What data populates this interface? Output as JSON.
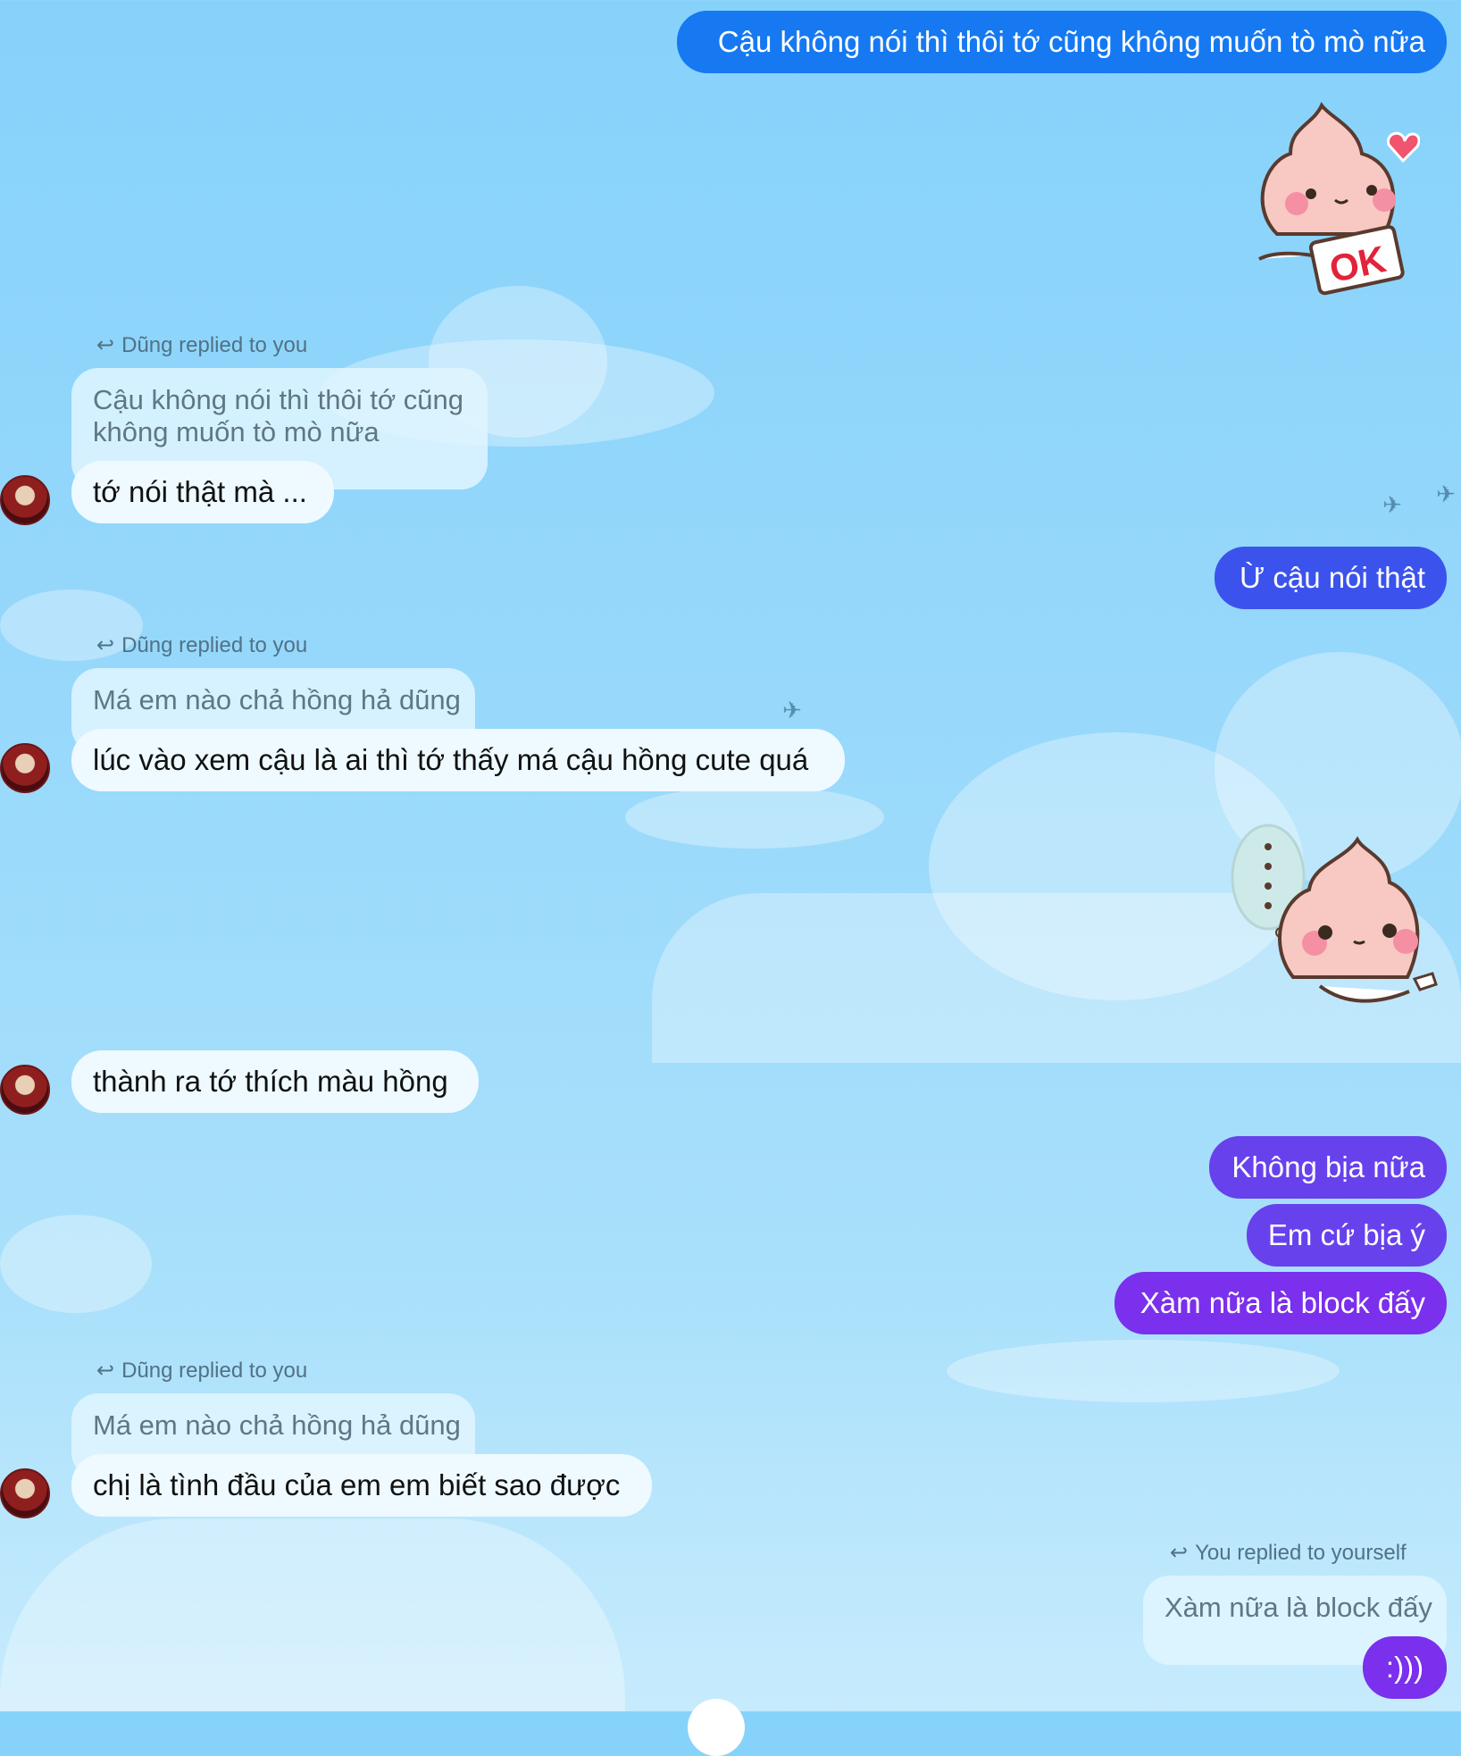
{
  "messages": {
    "m1": "Cậu không nói thì thôi tớ cũng không muốn tò mò nữa",
    "reply1_label": "Dũng replied to you",
    "reply1_quote": "Cậu không nói thì thôi tớ cũng không muốn tò mò nữa",
    "m2": "tớ nói thật mà ...",
    "m3": "Ừ cậu nói thật",
    "reply2_label": "Dũng replied to you",
    "reply2_quote": "Má em nào chả hồng hả dũng",
    "m4": "lúc vào xem cậu là ai thì tớ thấy má cậu hồng cute quá",
    "m5": "thành ra tớ thích màu hồng",
    "m6": "Không bịa nữa",
    "m7": "Em cứ bịa ý",
    "m8": "Xàm nữa là block đấy",
    "reply3_label": "Dũng replied to you",
    "reply3_quote": "Má em nào chả hồng hả dũng",
    "m9": "chị là tình đầu của em em biết sao được",
    "reply4_label": "You replied to yourself",
    "reply4_quote": "Xàm nữa là block đấy",
    "m10": ":)))"
  },
  "stickers": {
    "s1_text": "OK"
  },
  "colors": {
    "blue": "#1679f2",
    "indigo": "#3b53ec",
    "violet": "#6742ec",
    "purple": "#7a30ec",
    "incoming": "#eefaff"
  }
}
